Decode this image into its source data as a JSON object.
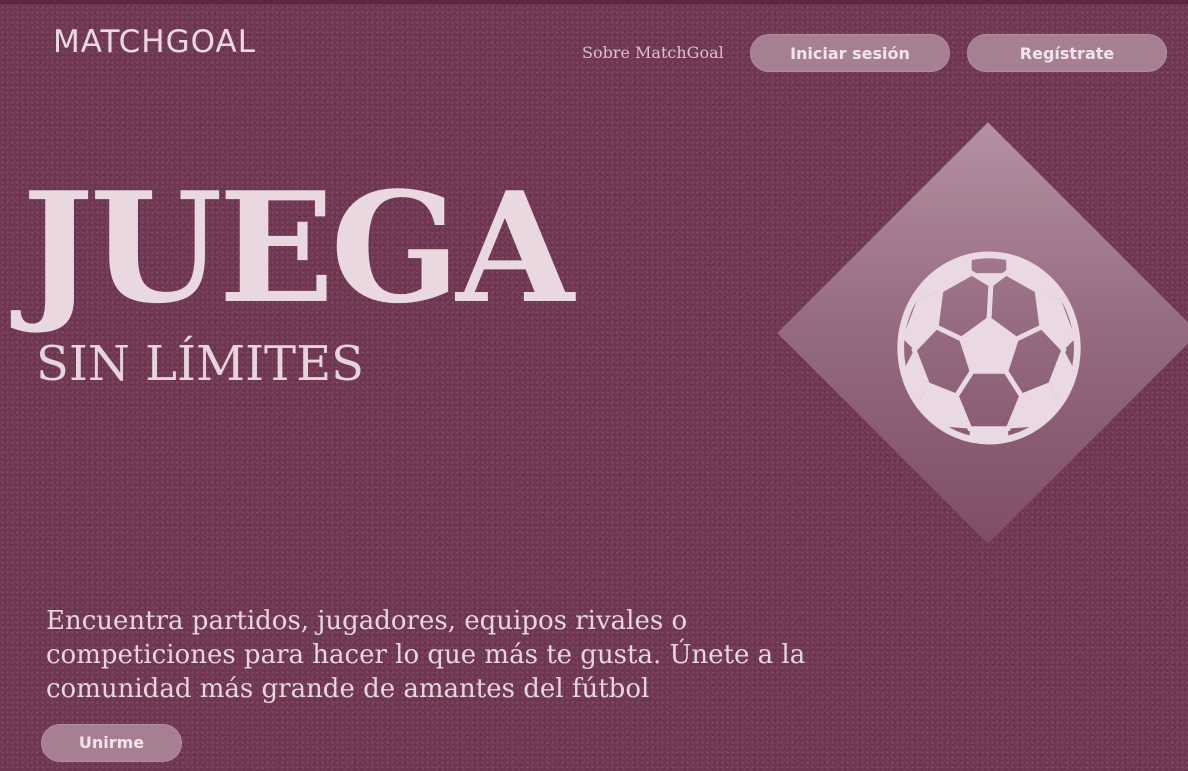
{
  "header": {
    "logo": "MATCHGOAL",
    "nav_about": "Sobre MatchGoal",
    "login_label": "Iniciar sesión",
    "register_label": "Regístrate"
  },
  "hero": {
    "title": "JUEGA",
    "subtitle": "SIN LÍMITES",
    "description": "Encuentra partidos, jugadores, equipos rivales o competiciones para hacer lo que más te gusta. Únete a la comunidad más grande de amantes del fútbol",
    "cta_label": "Unirme",
    "illustration_icon": "soccer-ball-icon"
  },
  "colors": {
    "background": "#6e3450",
    "text": "#e9d8e0",
    "button": "#a77f92",
    "diamond": "#956a80"
  }
}
